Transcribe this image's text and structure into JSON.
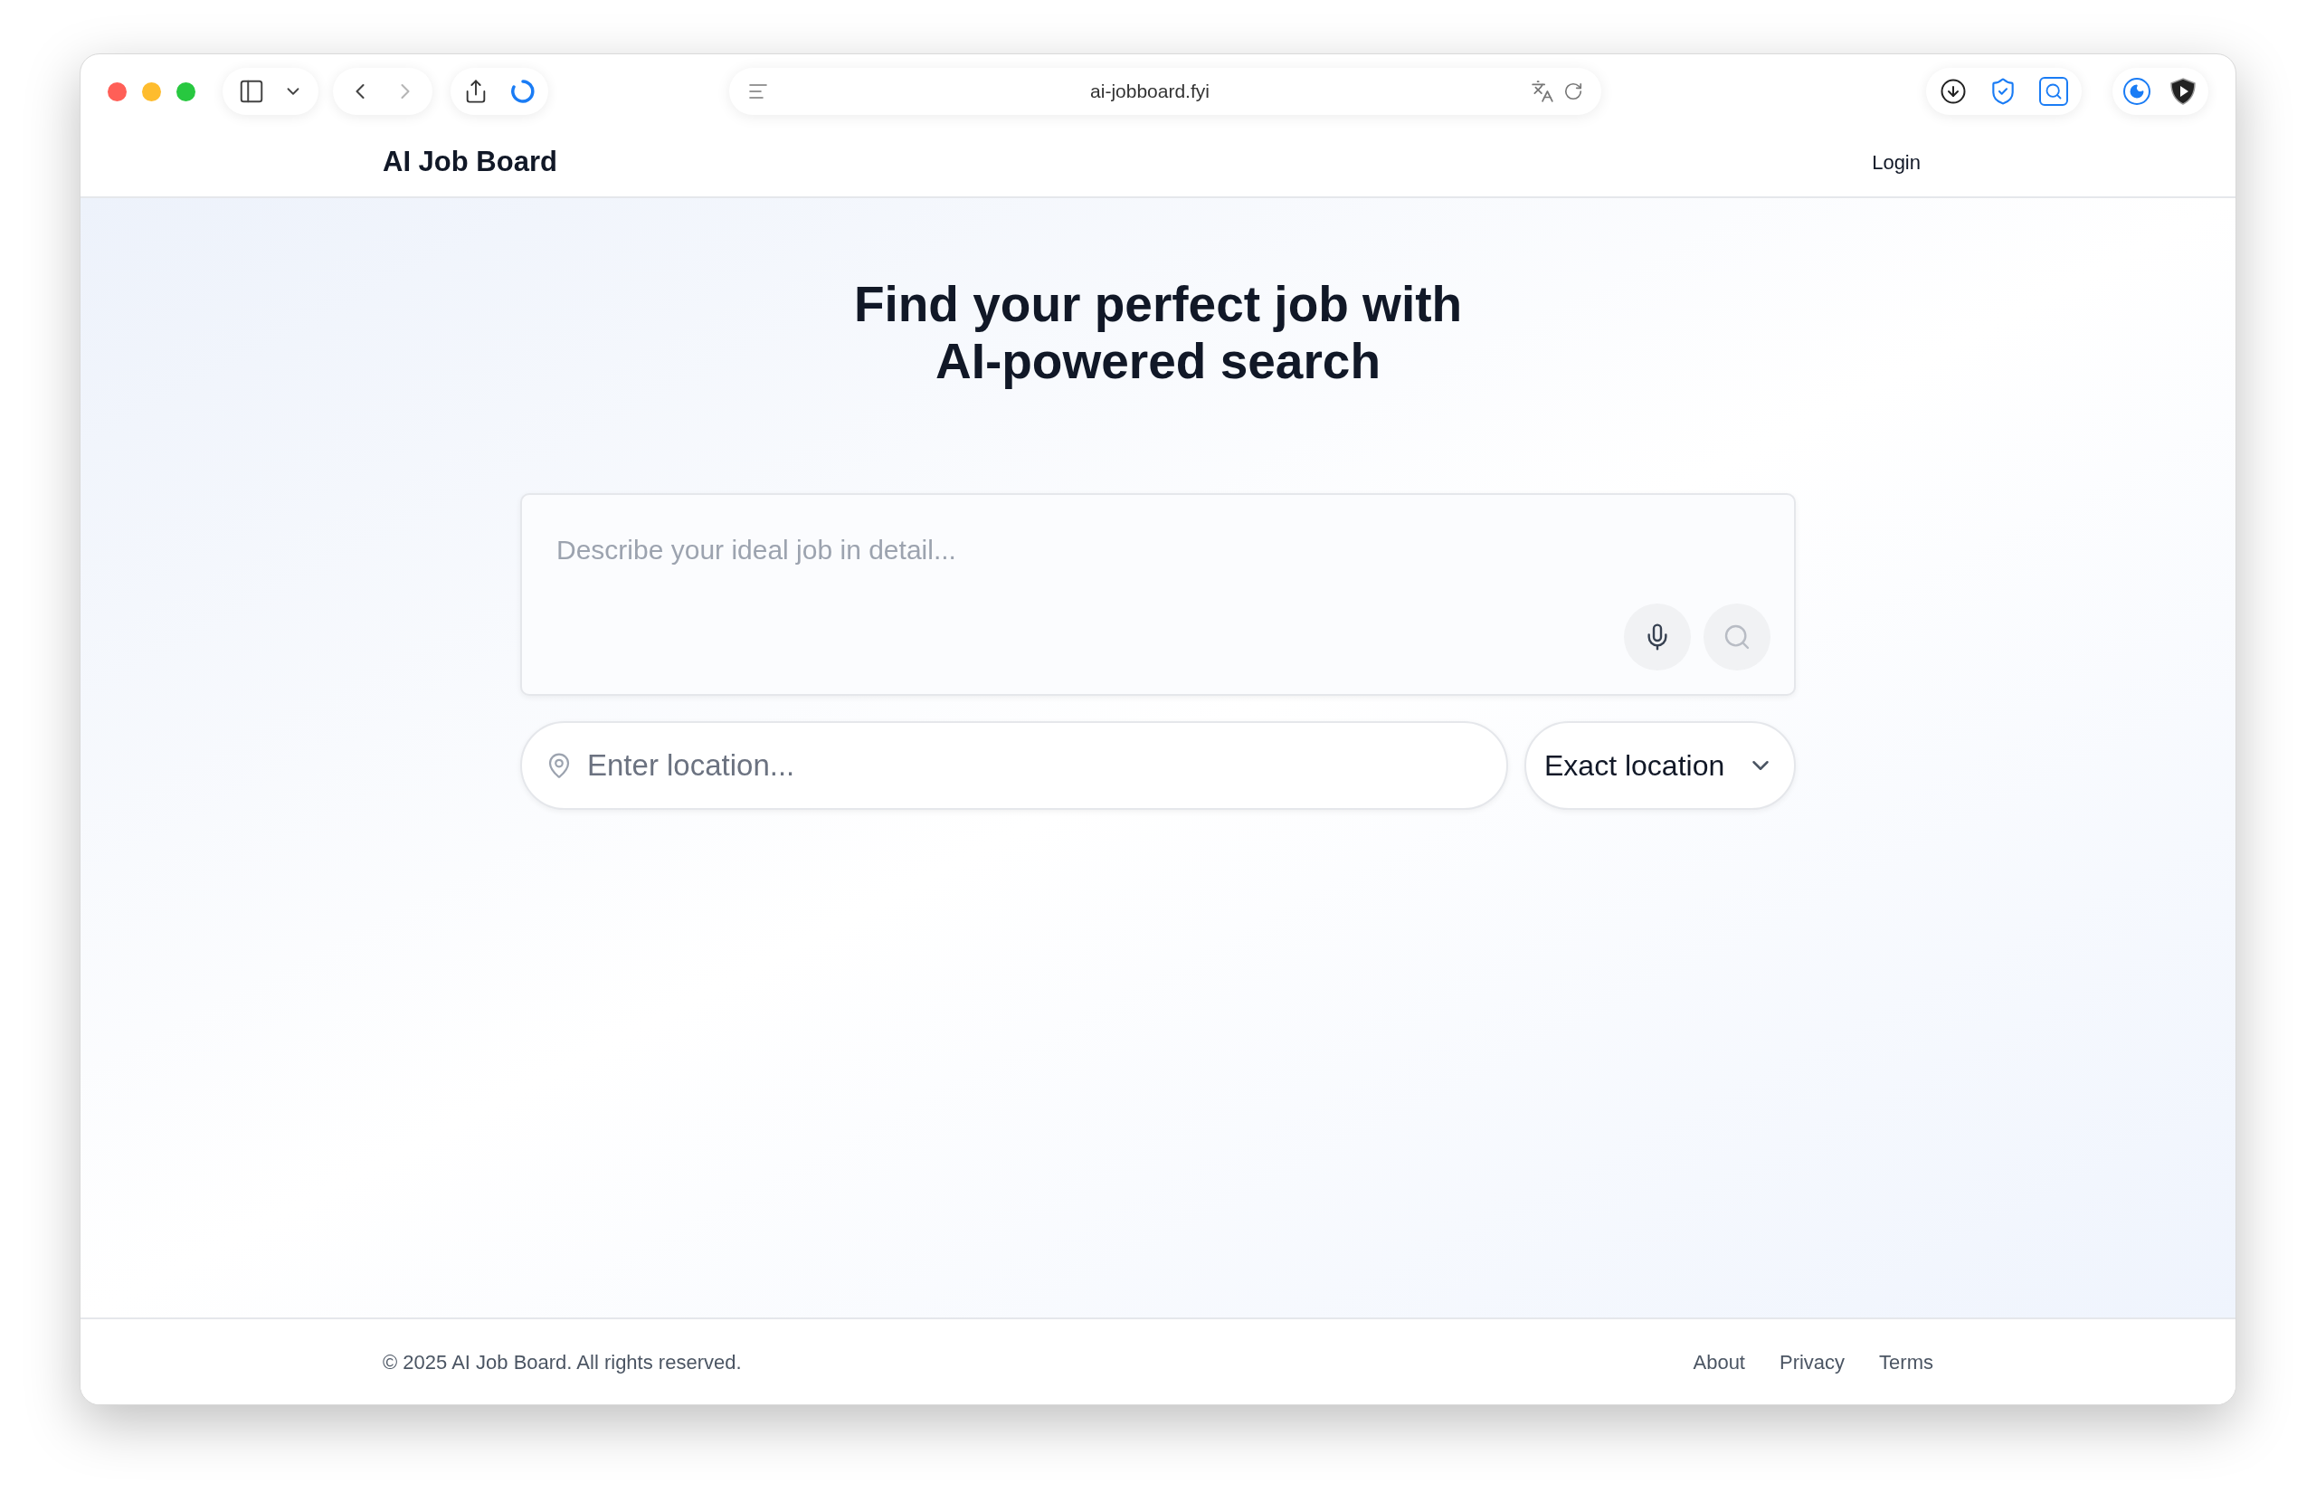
{
  "browser": {
    "url": "ai-jobboard.fyi",
    "nav_buttons": [
      {
        "kind": "back",
        "disabled": false
      },
      {
        "kind": "forward",
        "disabled": true
      }
    ]
  },
  "header": {
    "logo": "AI Job Board",
    "login": "Login"
  },
  "hero": {
    "heading": [
      "Find your perfect job with",
      "AI-powered search"
    ]
  },
  "search": {
    "placeholder": "Describe your ideal job in detail...",
    "search_disabled": true
  },
  "location": {
    "placeholder": "Enter location...",
    "mode": "Exact location"
  },
  "footer": {
    "copyright": "© 2025 AI Job Board. All rights reserved.",
    "links": [
      "About",
      "Privacy",
      "Terms"
    ]
  }
}
